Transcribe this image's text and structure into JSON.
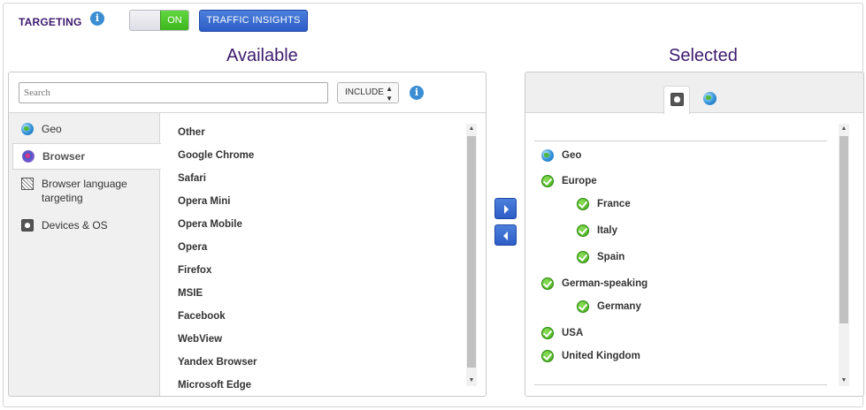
{
  "header": {
    "targeting_label": "TARGETING",
    "toggle_state": "ON",
    "traffic_insights_label": "TRAFFIC INSIGHTS",
    "accent_color": "#3d1a6e",
    "button_color": "#2c5ec7",
    "toggle_color": "#3db71d"
  },
  "available": {
    "heading": "Available",
    "search_placeholder": "Search",
    "include_value": "INCLUDE",
    "categories": [
      {
        "label": "Geo",
        "icon": "globe-icon"
      },
      {
        "label": "Browser",
        "icon": "browser-icon",
        "active": true
      },
      {
        "label": "Browser language targeting",
        "icon": "language-icon"
      },
      {
        "label": "Devices & OS",
        "icon": "device-icon"
      }
    ],
    "browsers": [
      "Other",
      "Google Chrome",
      "Safari",
      "Opera Mini",
      "Opera Mobile",
      "Opera",
      "Firefox",
      "MSIE",
      "Facebook",
      "WebView",
      "Yandex Browser",
      "Microsoft Edge"
    ]
  },
  "selected": {
    "heading": "Selected",
    "tabs": [
      {
        "icon": "device-icon",
        "active": true
      },
      {
        "icon": "globe-icon",
        "active": false
      }
    ],
    "items": [
      {
        "label": "Geo",
        "icon": "globe-icon"
      },
      {
        "label": "Europe",
        "icon": "check-icon"
      },
      {
        "label": "France",
        "icon": "check-icon"
      },
      {
        "label": "Italy",
        "icon": "check-icon"
      },
      {
        "label": "Spain",
        "icon": "check-icon"
      },
      {
        "label": "German-speaking",
        "icon": "check-icon"
      },
      {
        "label": "Germany",
        "icon": "check-icon"
      },
      {
        "label": "USA",
        "icon": "check-icon"
      },
      {
        "label": "United Kingdom",
        "icon": "check-icon"
      }
    ]
  }
}
